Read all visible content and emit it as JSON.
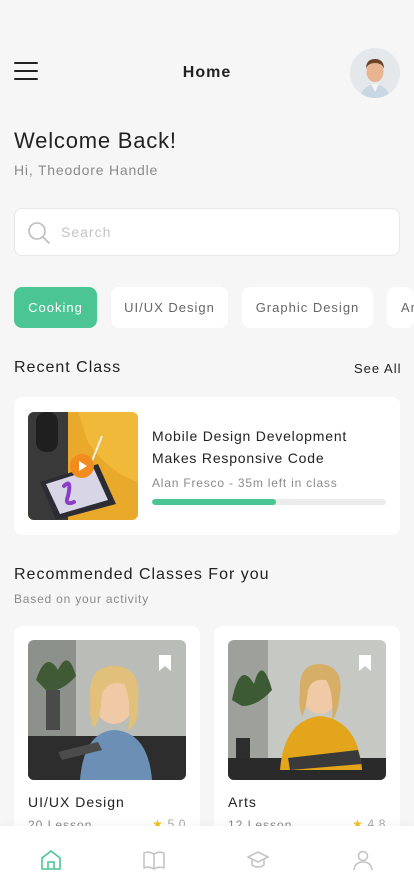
{
  "header": {
    "title": "Home",
    "avatar": "user-avatar"
  },
  "welcome": {
    "title": "Welcome Back!",
    "greeting": "Hi, Theodore Handle"
  },
  "search": {
    "placeholder": "Search",
    "icon": "search-icon"
  },
  "categories": [
    {
      "label": "Cooking",
      "active": true
    },
    {
      "label": "UI/UX Design",
      "active": false
    },
    {
      "label": "Graphic Design",
      "active": false
    },
    {
      "label": "Art",
      "active": false
    }
  ],
  "recent": {
    "section_title": "Recent Class",
    "see_all": "See All",
    "title": "Mobile Design Development Makes Responsive Code",
    "meta": "Alan Fresco - 35m left in class",
    "progress": 0.53
  },
  "recommended": {
    "section_title": "Recommended Classes For you",
    "subtitle": "Based on your activity",
    "classes": [
      {
        "name": "UI/UX Design",
        "lessons": "20 Lesson",
        "rating": "5.0"
      },
      {
        "name": "Arts",
        "lessons": "12 Lesson",
        "rating": "4.8"
      }
    ]
  },
  "bottom_nav": [
    {
      "icon": "home-icon",
      "active": true
    },
    {
      "icon": "book-icon",
      "active": false
    },
    {
      "icon": "graduation-cap-icon",
      "active": false
    },
    {
      "icon": "profile-icon",
      "active": false
    }
  ],
  "colors": {
    "accent": "#4cc594",
    "star": "#f2c21b",
    "play": "#f28c1e"
  }
}
